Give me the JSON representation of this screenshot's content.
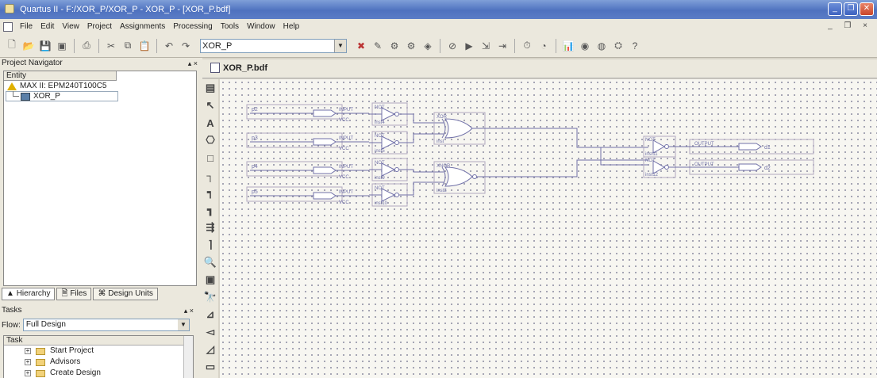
{
  "window": {
    "title": "Quartus II - F:/XOR_P/XOR_P - XOR_P - [XOR_P.bdf]"
  },
  "menu": [
    "File",
    "Edit",
    "View",
    "Project",
    "Assignments",
    "Processing",
    "Tools",
    "Window",
    "Help"
  ],
  "toolbar": {
    "project_combo": "XOR_P"
  },
  "project_navigator": {
    "title": "Project Navigator",
    "entity_header": "Entity",
    "device": "MAX II: EPM240T100C5",
    "top_entity": "XOR_P",
    "tabs": [
      "Hierarchy",
      "Files",
      "Design Units"
    ]
  },
  "tasks": {
    "title": "Tasks",
    "flow_label": "Flow:",
    "flow_value": "Full Design",
    "task_header": "Task",
    "items": [
      "Start Project",
      "Advisors",
      "Create Design"
    ]
  },
  "document": {
    "tab_label": "XOR_P.bdf"
  },
  "schematic": {
    "inputs": [
      {
        "name": "p2",
        "type": "INPUT",
        "sub": "VCC"
      },
      {
        "name": "p3",
        "type": "INPUT",
        "sub": "VCC"
      },
      {
        "name": "p4",
        "type": "INPUT",
        "sub": "VCC"
      },
      {
        "name": "p5",
        "type": "INPUT",
        "sub": "VCC"
      }
    ],
    "not_gates": [
      {
        "type": "NOT",
        "inst": "inst4"
      },
      {
        "type": "NOT",
        "inst": "inst5"
      },
      {
        "type": "NOT",
        "inst": "inst9"
      },
      {
        "type": "NOT",
        "inst": "inst10"
      }
    ],
    "xor_gates": [
      {
        "type": "XOR",
        "inst": "inst"
      },
      {
        "type": "XNOR",
        "inst": "inst3"
      }
    ],
    "out_not_gates": [
      {
        "type": "NOT",
        "inst": "inst11"
      },
      {
        "type": "NOT",
        "inst": "inst12"
      }
    ],
    "outputs": [
      {
        "name": "d1",
        "type": "OUTPUT"
      },
      {
        "name": "d2",
        "type": "OUTPUT"
      }
    ]
  }
}
